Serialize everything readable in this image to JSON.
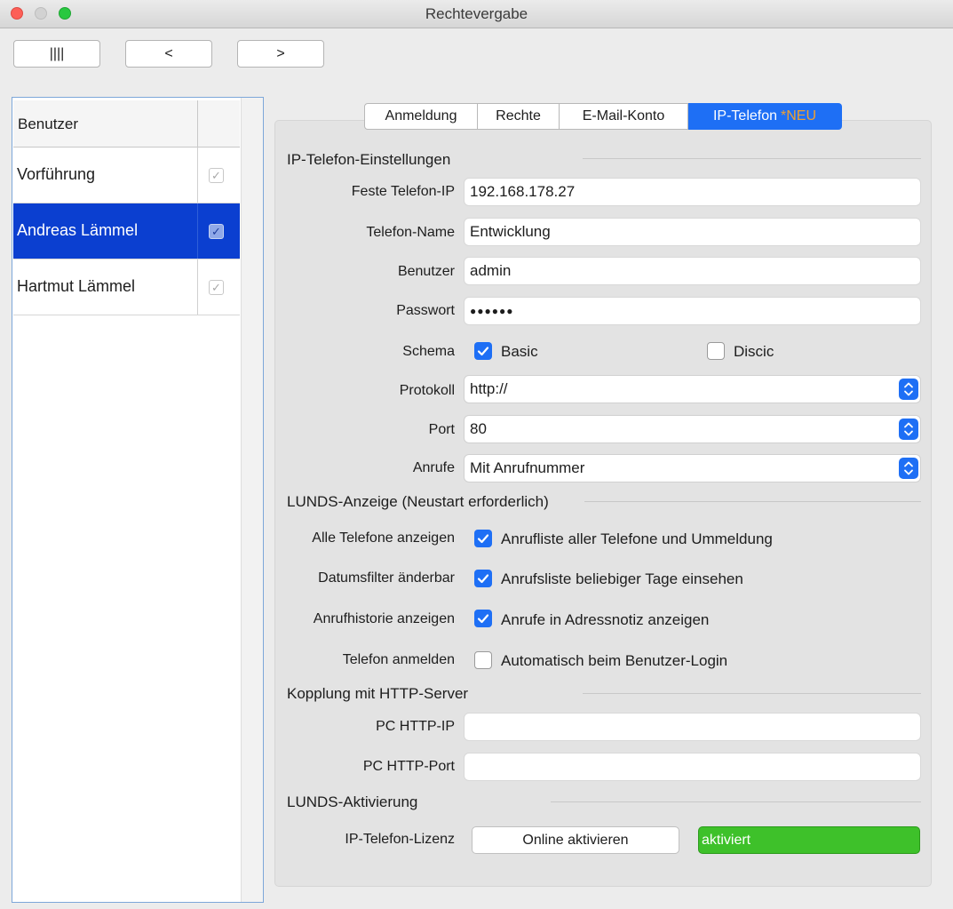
{
  "window": {
    "title": "Rechtevergabe"
  },
  "nav": {
    "columns_label": "||||",
    "prev_label": "<",
    "next_label": ">"
  },
  "user_list": {
    "header": "Benutzer",
    "rows": [
      {
        "name": "Vorführung",
        "checked": true
      },
      {
        "name": "Andreas Lämmel",
        "checked": true,
        "selected": true
      },
      {
        "name": "Hartmut Lämmel",
        "checked": true
      }
    ]
  },
  "tabs": [
    {
      "label": "Anmeldung"
    },
    {
      "label": "Rechte"
    },
    {
      "label": "E-Mail-Konto"
    },
    {
      "label": "IP-Telefon",
      "badge": "*NEU",
      "active": true
    }
  ],
  "ip_settings": {
    "section_title": "IP-Telefon-Einstellungen",
    "fixed_ip_label": "Feste Telefon-IP",
    "fixed_ip_value": "192.168.178.27",
    "phone_name_label": "Telefon-Name",
    "phone_name_value": "Entwicklung",
    "user_label": "Benutzer",
    "user_value": "admin",
    "password_label": "Passwort",
    "password_value": "●●●●●●",
    "schema_label": "Schema",
    "schema_basic_label": "Basic",
    "schema_basic_checked": true,
    "schema_discic_label": "Discic",
    "schema_discic_checked": false,
    "protocol_label": "Protokoll",
    "protocol_value": "http://",
    "port_label": "Port",
    "port_value": "80",
    "calls_label": "Anrufe",
    "calls_value": "Mit Anrufnummer"
  },
  "lunds_display": {
    "section_title": "LUNDS-Anzeige (Neustart erforderlich)",
    "rows": [
      {
        "label": "Alle Telefone anzeigen",
        "option": "Anrufliste aller Telefone und Ummeldung",
        "checked": true
      },
      {
        "label": "Datumsfilter änderbar",
        "option": "Anrufsliste beliebiger Tage einsehen",
        "checked": true
      },
      {
        "label": "Anrufhistorie anzeigen",
        "option": "Anrufe in Adressnotiz anzeigen",
        "checked": true
      },
      {
        "label": "Telefon anmelden",
        "option": "Automatisch beim Benutzer-Login",
        "checked": false
      }
    ]
  },
  "http_server": {
    "section_title": "Kopplung mit HTTP-Server",
    "pc_ip_label": "PC HTTP-IP",
    "pc_ip_value": "",
    "pc_port_label": "PC HTTP-Port",
    "pc_port_value": ""
  },
  "activation": {
    "section_title": "LUNDS-Aktivierung",
    "license_label": "IP-Telefon-Lizenz",
    "button_label": "Online aktivieren",
    "status": "aktiviert"
  },
  "colors": {
    "accent": "#1e6ff5",
    "selection": "#0b3fd0",
    "status_ok": "#3ec12a",
    "badge": "#f0a030"
  }
}
